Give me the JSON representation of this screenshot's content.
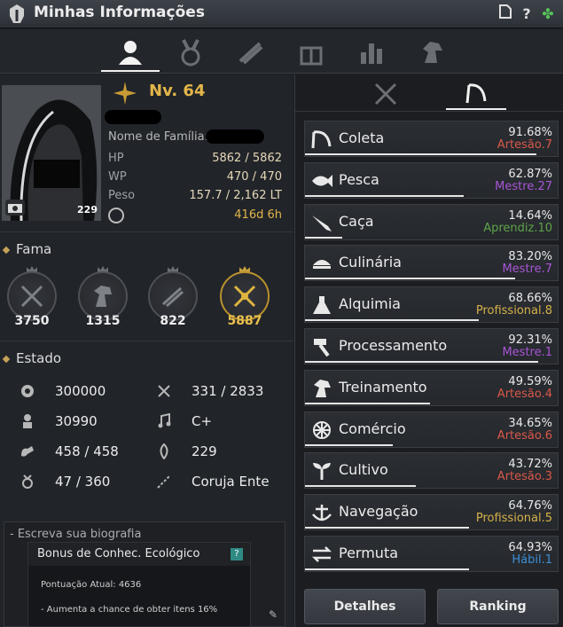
{
  "window": {
    "title": "Minhas Informações",
    "icons": [
      "warrior-helmet-icon",
      "document-icon",
      "help-icon",
      "clover-icon"
    ]
  },
  "top_tabs": [
    {
      "name": "profile",
      "icon": "person-icon",
      "active": true
    },
    {
      "name": "medals",
      "icon": "medal-icon",
      "active": false
    },
    {
      "name": "quests",
      "icon": "scroll-icon",
      "active": false
    },
    {
      "name": "gifts",
      "icon": "gift-icon",
      "active": false
    },
    {
      "name": "stats",
      "icon": "bar-chart-icon",
      "active": false
    },
    {
      "name": "pets",
      "icon": "horse-icon",
      "active": false
    }
  ],
  "profile": {
    "level": "Nv. 64",
    "family_label": "Nome de Família:",
    "portrait_number": "229",
    "stats": [
      {
        "key": "HP",
        "value": "5862 / 5862"
      },
      {
        "key": "WP",
        "value": "470 / 470"
      },
      {
        "key": "Peso",
        "value": "157.7 / 2,162 LT"
      }
    ],
    "playtime": "416d 6h"
  },
  "fame": {
    "title": "Fama",
    "items": [
      {
        "icon": "crossed-swords-icon",
        "value": "3750",
        "gold": false
      },
      {
        "icon": "horse-head-icon",
        "value": "1315",
        "gold": false
      },
      {
        "icon": "scroll-icon",
        "value": "822",
        "gold": false
      },
      {
        "icon": "crossed-tools-icon",
        "value": "5887",
        "gold": true
      }
    ]
  },
  "estado": {
    "title": "Estado",
    "items": [
      {
        "icon": "energy-icon",
        "value": "300000"
      },
      {
        "icon": "axe-icon",
        "value": "331 / 2833"
      },
      {
        "icon": "contribution-icon",
        "value": "30990"
      },
      {
        "icon": "music-icon",
        "value": "C+"
      },
      {
        "icon": "strength-icon",
        "value": "458 / 458"
      },
      {
        "icon": "karma-icon",
        "value": "229"
      },
      {
        "icon": "ring-icon",
        "value": "47 / 360"
      },
      {
        "icon": "rod-icon",
        "value": "Coruja Ente"
      }
    ]
  },
  "bio": {
    "label": "- Escreva sua biografia",
    "tooltip_title": "Bonus de Conhec. Ecológico",
    "tooltip_help": "?",
    "lines": [
      "Pontuação Atual: 4636",
      "- Aumenta a chance de obter itens 16%"
    ]
  },
  "skills": [
    {
      "name": "Coleta",
      "icon": "sickle-icon",
      "percent": "91.68%",
      "rank": "Artesão.7",
      "rank_color": "#d9584a",
      "progress": 0.9168
    },
    {
      "name": "Pesca",
      "icon": "fish-icon",
      "percent": "62.87%",
      "rank": "Mestre.27",
      "rank_color": "#a855d6",
      "progress": 0.6287
    },
    {
      "name": "Caça",
      "icon": "rifle-icon",
      "percent": "14.64%",
      "rank": "Aprendiz.10",
      "rank_color": "#5ea44a",
      "progress": 0.1464
    },
    {
      "name": "Culinária",
      "icon": "cooking-icon",
      "percent": "83.20%",
      "rank": "Mestre.7",
      "rank_color": "#a855d6",
      "progress": 0.832
    },
    {
      "name": "Alquimia",
      "icon": "flask-icon",
      "percent": "68.66%",
      "rank": "Profissional.8",
      "rank_color": "#d6b24a",
      "progress": 0.6866
    },
    {
      "name": "Processamento",
      "icon": "hammer-icon",
      "percent": "92.31%",
      "rank": "Mestre.1",
      "rank_color": "#a855d6",
      "progress": 0.9231
    },
    {
      "name": "Treinamento",
      "icon": "horse-icon",
      "percent": "49.59%",
      "rank": "Artesão.4",
      "rank_color": "#d9584a",
      "progress": 0.4959
    },
    {
      "name": "Comércio",
      "icon": "wheel-icon",
      "percent": "34.65%",
      "rank": "Artesão.6",
      "rank_color": "#d9584a",
      "progress": 0.3465
    },
    {
      "name": "Cultivo",
      "icon": "sprout-icon",
      "percent": "43.72%",
      "rank": "Artesão.3",
      "rank_color": "#d9584a",
      "progress": 0.4372
    },
    {
      "name": "Navegação",
      "icon": "anchor-icon",
      "percent": "64.76%",
      "rank": "Profissional.5",
      "rank_color": "#d6b24a",
      "progress": 0.6476
    },
    {
      "name": "Permuta",
      "icon": "exchange-icon",
      "percent": "64.93%",
      "rank": "Hábil.1",
      "rank_color": "#3c8fd6",
      "progress": 0.6493
    }
  ],
  "buttons": {
    "details": "Detalhes",
    "ranking": "Ranking"
  }
}
